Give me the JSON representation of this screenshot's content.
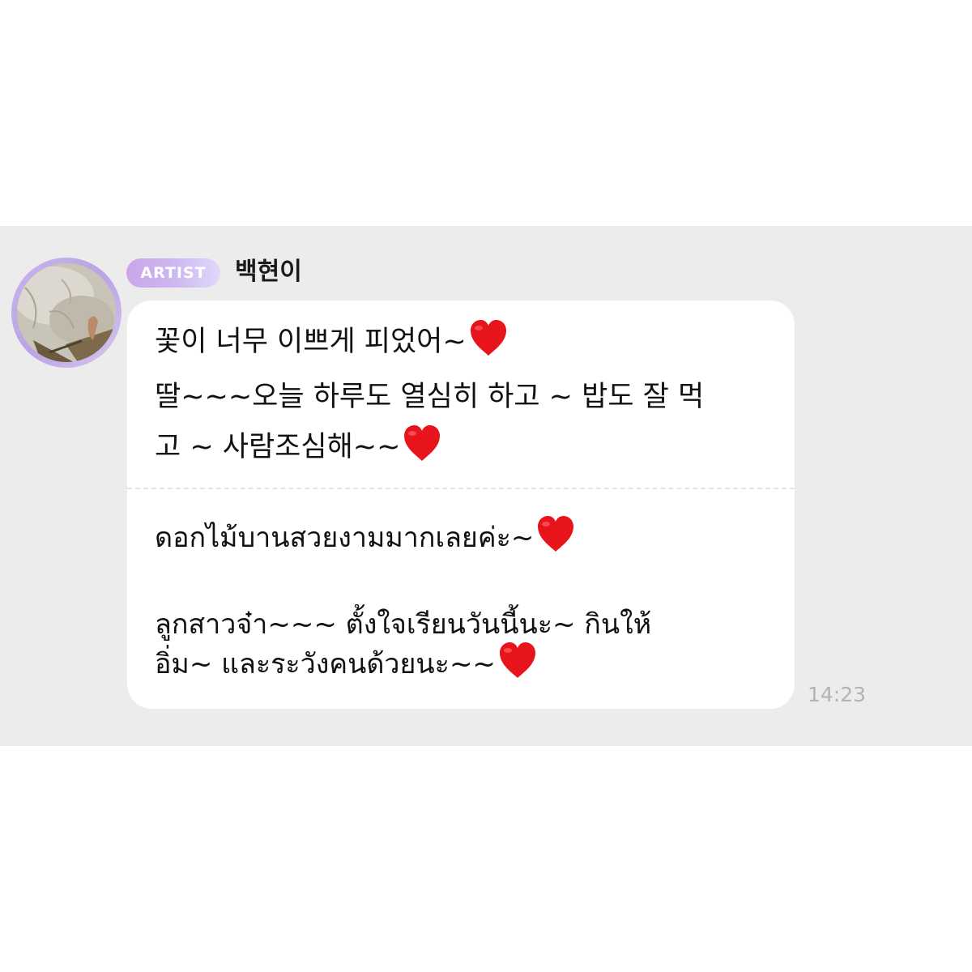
{
  "message": {
    "badge": "ARTIST",
    "sender": "백현이",
    "korean_lines": [
      "꽃이 너무 이쁘게 피었어~",
      "딸~~~오늘 하루도 열심히 하고 ~ 밥도 잘 먹",
      "고 ~ 사람조심해~~"
    ],
    "thai_lines": [
      "ดอกไม้บานสวยงามมากเลยค่ะ~",
      "ลูกสาวจ๋า~~~ ตั้งใจเรียนวันนี้นะ~ กินให้",
      "อิ่ม~ และระวังคนด้วยนะ~~"
    ],
    "time": "14:23"
  },
  "icons": {
    "heart": "red-heart-emoji",
    "avatar": "profile-photo"
  },
  "colors": {
    "band_background": "#ececec",
    "bubble_background": "#ffffff",
    "badge_gradient_start": "#c9a6ea",
    "badge_gradient_end": "#e1d8fb",
    "heart": "#e8141c",
    "timestamp": "#b3b3b3"
  }
}
